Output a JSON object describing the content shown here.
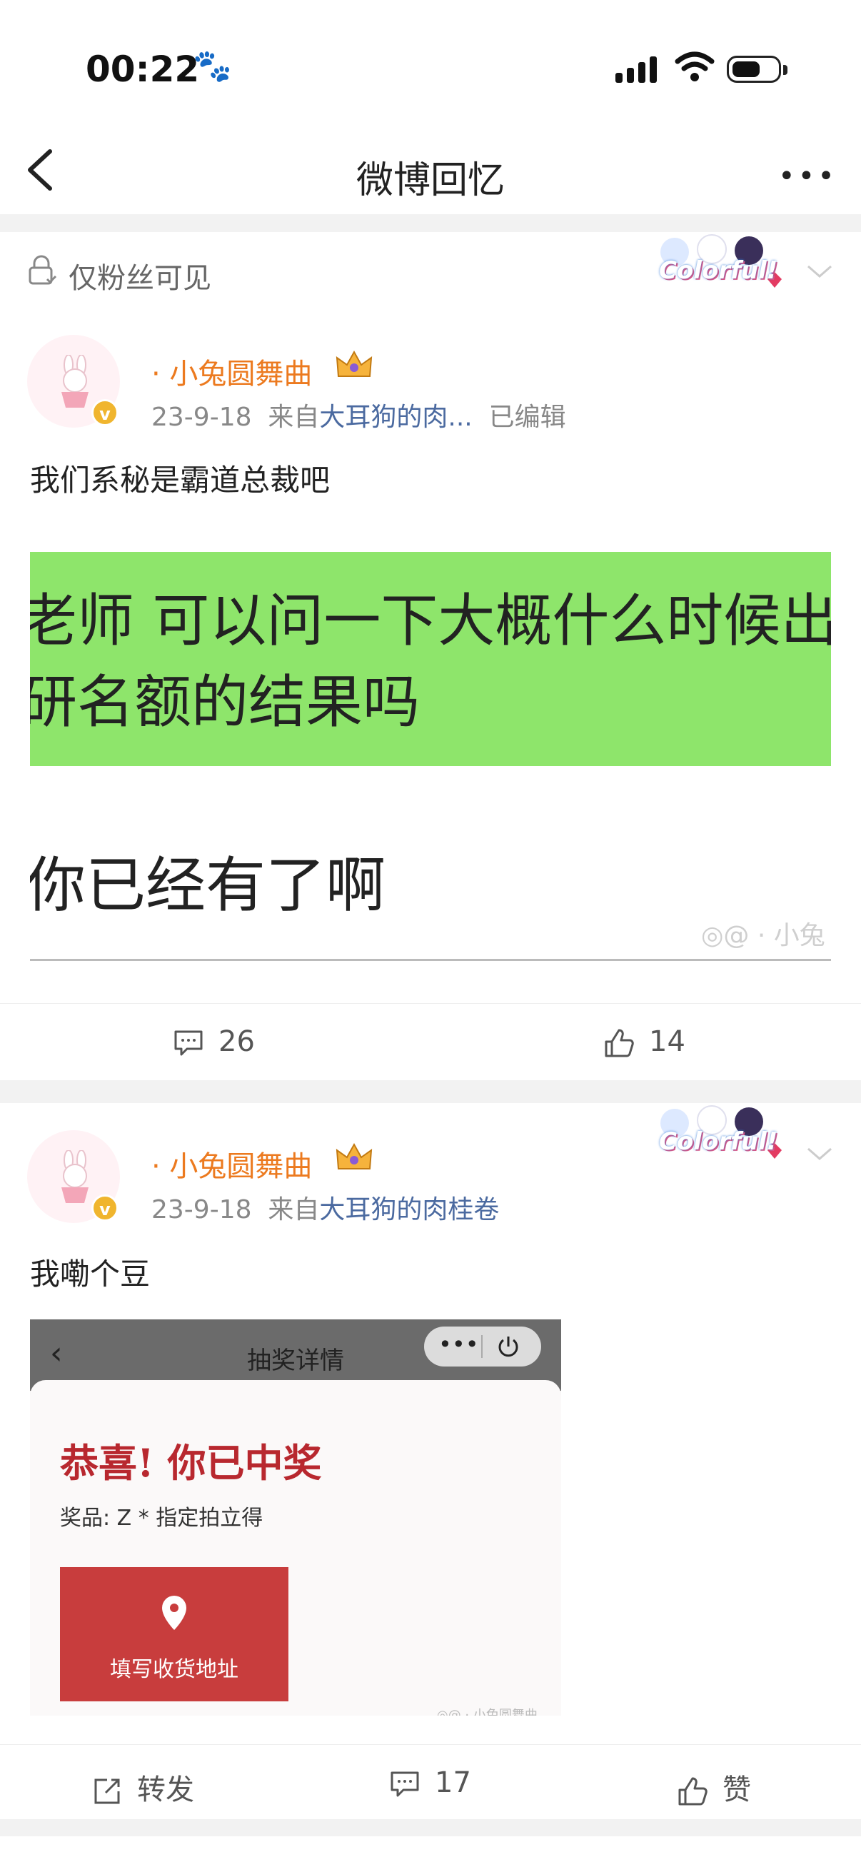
{
  "status_bar": {
    "time": "00:22",
    "paw_icon": "🐾"
  },
  "nav": {
    "title": "微博回忆",
    "more": "•••"
  },
  "visibility": {
    "label": "仅粉丝可见"
  },
  "badge_text": "Colorful!",
  "posts": [
    {
      "username": "· 小兔圆舞曲",
      "date": "23-9-18",
      "from_prefix": "来自",
      "source": "大耳狗的肉...",
      "edited": "已编辑",
      "text": "我们系秘是霸道总裁吧",
      "image": {
        "line1": "老师 可以问一下大概什么时候出保",
        "line2": "研名额的结果吗",
        "reply": "你已经有了啊",
        "watermark": "◎@ · 小兔"
      },
      "comments": "26",
      "likes": "14"
    },
    {
      "username": "· 小兔圆舞曲",
      "date": "23-9-18",
      "from_prefix": "来自",
      "source": "大耳狗的肉桂卷",
      "text": "我嘞个豆",
      "image": {
        "title": "抽奖详情",
        "dots": "•••",
        "congrats": "恭喜! 你已中奖",
        "prize": "奖品: Z * 指定拍立得",
        "button": "填写收货地址",
        "watermark": "◎@ · 小兔圆舞曲"
      },
      "repost": "转发",
      "comments": "17",
      "like": "赞"
    }
  ],
  "colors": {
    "orange_name": "#ec7a1f",
    "link_blue": "#4b6aa0",
    "green_bubble": "#8ee56b",
    "red_button": "#c83d3d",
    "red_text": "#b8282f"
  }
}
